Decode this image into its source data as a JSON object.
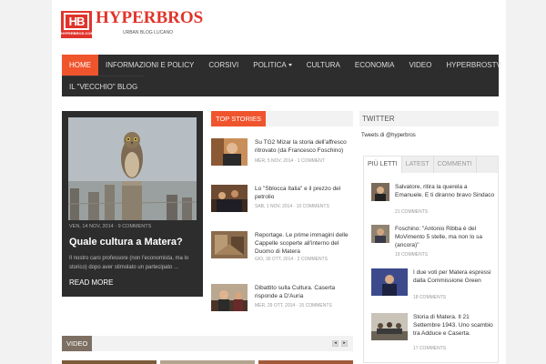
{
  "logo": {
    "box_text": "HB",
    "box_sub": "HYPERBROS.COM",
    "name": "HYPERBROS",
    "tagline": "URBAN BLOG LUCANO"
  },
  "nav": {
    "row1": [
      "HOME",
      "INFORMAZIONI E POLICY",
      "CORSIVI",
      "POLITICA",
      "CULTURA",
      "ECONOMIA",
      "VIDEO",
      "HYPERBROSTV"
    ],
    "row2": [
      "IL \"VECCHIO\" BLOG"
    ],
    "active": "HOME",
    "dropdown": "POLITICA"
  },
  "featured": {
    "meta": "VEN, 14 NOV, 2014 · 9 COMMENTS",
    "title": "Quale cultura a Matera?",
    "excerpt": "Il nostro caro professore (non l'economista, ma lo storico) dopo aver stimolato un partecipato ...",
    "more": "READ MORE"
  },
  "top_stories": {
    "label": "TOP STORIES",
    "items": [
      {
        "title": "Su TG2 Mizar la storia dell'affresco ritrovato (da Francesco Foschino)",
        "meta": "MER, 5 NOV, 2014 · 1 COMMENT"
      },
      {
        "title": "Lo \"Sblocca Italia\" e il prezzo del petrolio",
        "meta": "SAB, 1 NOV, 2014 · 10 COMMENTS"
      },
      {
        "title": "Reportage. Le prime immagini delle Cappelle scoperte all'interno del Duomo di Matera",
        "meta": "GIO, 30 OTT, 2014 · 2 COMMENTS"
      },
      {
        "title": "Dibattito sulla Cultura. Caserta risponde a D'Auria",
        "meta": "MER, 29 OTT, 2014 · 15 COMMENTS"
      }
    ]
  },
  "twitter": {
    "label": "TWITTER",
    "text": "Tweets di @hyperbros"
  },
  "tabs": {
    "labels": [
      "PIÙ LETTI",
      "LATEST",
      "COMMENTI"
    ],
    "active": "PIÙ LETTI",
    "items": [
      {
        "title": "Salvatore, ritira la querela a Emanuele. E ti diranno bravo Sindaco",
        "meta": "21 COMMENTS"
      },
      {
        "title": "Foschino: \"Antonio Ribba è del MoVimento 5 stelle, ma non lo sa (ancora)\"",
        "meta": "19 COMMENTS"
      },
      {
        "title": "I due voti per Matera espressi dalla Commissione Green",
        "meta": "18 COMMENTS"
      },
      {
        "title": "Storia di Matera. Il 21 Settembre 1943. Uno scambio tra Adduce e Caserta.",
        "meta": "17 COMMENTS"
      }
    ]
  },
  "video": {
    "label": "VIDEO",
    "prev": "◂",
    "next": "▸"
  },
  "colors": {
    "accent": "#f0542d",
    "brand": "#e0342b",
    "nav_bg": "#2d2d2d"
  }
}
